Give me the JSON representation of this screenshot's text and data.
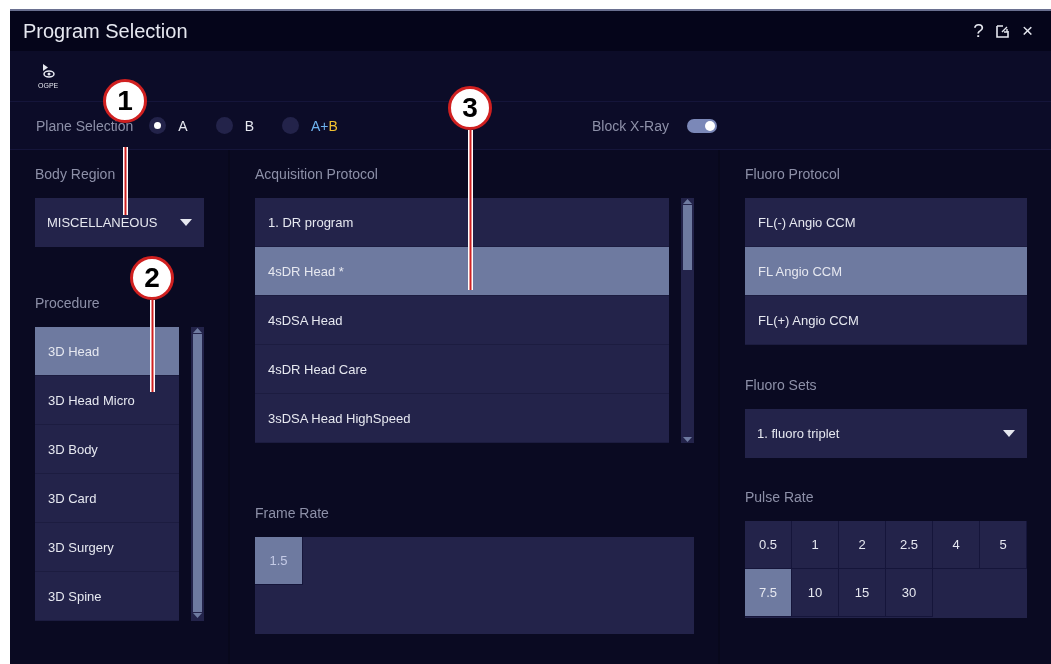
{
  "window": {
    "title": "Program Selection",
    "buttons": [
      "?",
      "×"
    ]
  },
  "toolbar": {
    "label": "OGPE"
  },
  "plane_selection": {
    "label": "Plane Selection",
    "options": [
      {
        "parts": [
          {
            "text": "A",
            "color": "#e6e8f0"
          }
        ],
        "selected": true
      },
      {
        "parts": [
          {
            "text": "B",
            "color": "#e6e8f0"
          }
        ],
        "selected": false
      },
      {
        "parts": [
          {
            "text": "A+",
            "color": "#6fb4f0"
          },
          {
            "text": "B",
            "color": "#f0c030"
          }
        ],
        "selected": false
      }
    ]
  },
  "block_xray": {
    "label": "Block X-Ray",
    "on": true
  },
  "body_region": {
    "label": "Body Region",
    "value": "MISCELLANEOUS"
  },
  "procedure": {
    "label": "Procedure",
    "items": [
      {
        "label": "3D Head",
        "selected": true
      },
      {
        "label": "3D Head Micro",
        "selected": false
      },
      {
        "label": "3D Body",
        "selected": false
      },
      {
        "label": "3D Card",
        "selected": false
      },
      {
        "label": "3D Surgery",
        "selected": false
      },
      {
        "label": "3D Spine",
        "selected": false
      }
    ]
  },
  "acquisition_protocol": {
    "label": "Acquisition Protocol",
    "items": [
      {
        "label": "1. DR program",
        "selected": false
      },
      {
        "label": "4sDR Head *",
        "selected": true
      },
      {
        "label": "4sDSA Head",
        "selected": false
      },
      {
        "label": "4sDR Head Care",
        "selected": false
      },
      {
        "label": "3sDSA Head HighSpeed",
        "selected": false
      }
    ]
  },
  "frame_rate": {
    "label": "Frame Rate",
    "options": [
      {
        "label": "1.5",
        "selected": true
      }
    ]
  },
  "fluoro_protocol": {
    "label": "Fluoro Protocol",
    "items": [
      {
        "label": "FL(-) Angio CCM",
        "selected": false
      },
      {
        "label": "FL  Angio CCM",
        "selected": true
      },
      {
        "label": "FL(+) Angio CCM",
        "selected": false
      }
    ]
  },
  "fluoro_sets": {
    "label": "Fluoro Sets",
    "value": "1. fluoro triplet"
  },
  "pulse_rate": {
    "label": "Pulse Rate",
    "options": [
      {
        "label": "0.5",
        "selected": false
      },
      {
        "label": "1",
        "selected": false
      },
      {
        "label": "2",
        "selected": false
      },
      {
        "label": "2.5",
        "selected": false
      },
      {
        "label": "4",
        "selected": false
      },
      {
        "label": "5",
        "selected": false
      },
      {
        "label": "7.5",
        "selected": true
      },
      {
        "label": "10",
        "selected": false
      },
      {
        "label": "15",
        "selected": false
      },
      {
        "label": "30",
        "selected": false
      }
    ]
  },
  "callouts": [
    {
      "number": "1"
    },
    {
      "number": "2"
    },
    {
      "number": "3"
    }
  ]
}
